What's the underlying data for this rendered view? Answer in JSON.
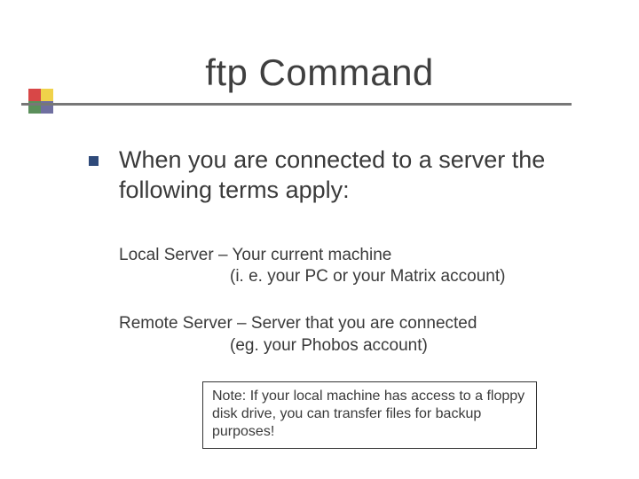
{
  "title": "ftp Command",
  "lead": "When you are connected to a server the following terms apply:",
  "local": {
    "line1": "Local Server – Your current machine",
    "line2": "(i. e. your PC or your Matrix account)"
  },
  "remote": {
    "line1": "Remote Server – Server that you are connected",
    "line2": "(eg. your Phobos account)"
  },
  "note": "Note: If your local machine has access to a floppy disk drive, you can transfer files for backup purposes!"
}
